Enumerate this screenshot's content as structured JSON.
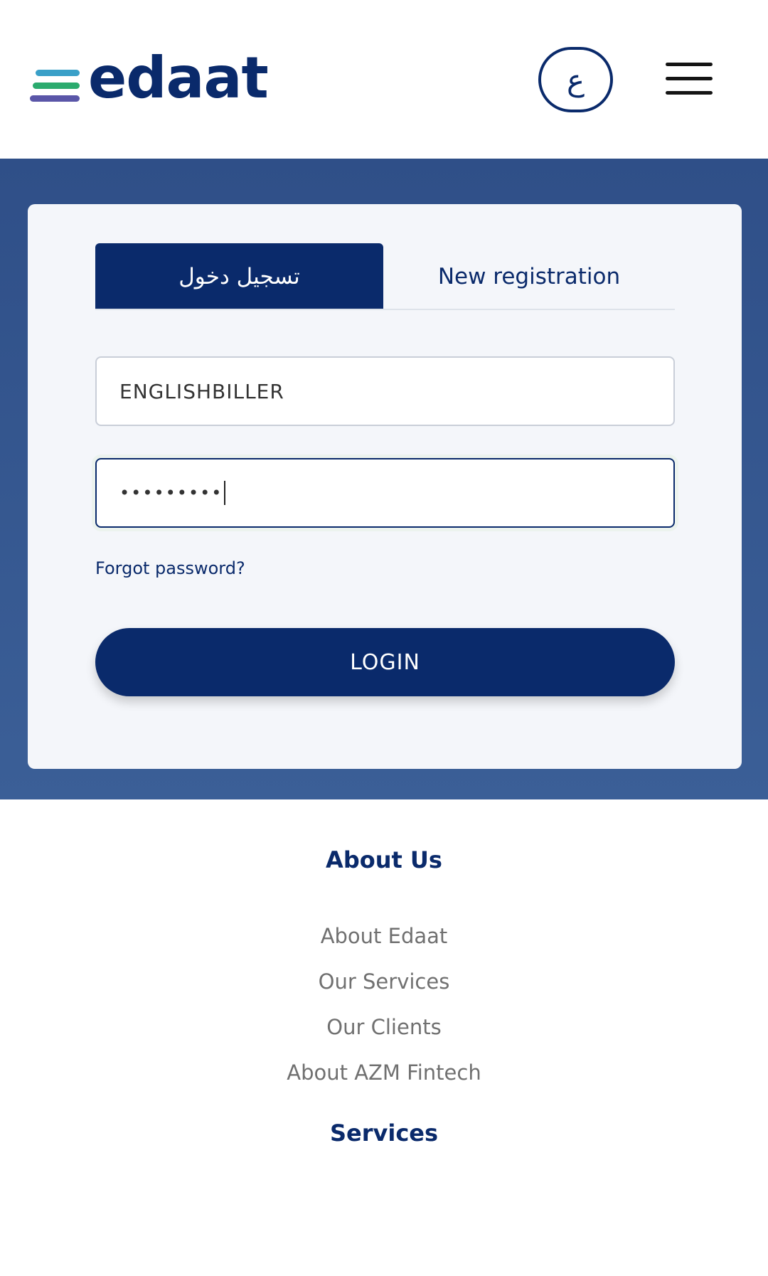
{
  "header": {
    "logo_text": "edaat",
    "logo_reg": "®",
    "language_toggle": "ع",
    "menu_icon": "hamburger-menu-icon"
  },
  "login_card": {
    "tabs": [
      {
        "label": "تسجيل دخول",
        "active": true
      },
      {
        "label": "New registration",
        "active": false
      }
    ],
    "username": {
      "value": "ENGLISHBILLER"
    },
    "password": {
      "value": "•••••••••"
    },
    "forgot_password": "Forgot password?",
    "login_button": "LOGIN"
  },
  "footer": {
    "about_heading": "About Us",
    "about_links": [
      "About Edaat",
      "Our Services",
      "Our Clients",
      "About AZM Fintech"
    ],
    "services_heading": "Services"
  },
  "colors": {
    "brand_navy": "#0a2a6b",
    "hero_blue": "#2f4f88",
    "card_bg": "#f4f6fa",
    "link_gray": "#707070"
  }
}
